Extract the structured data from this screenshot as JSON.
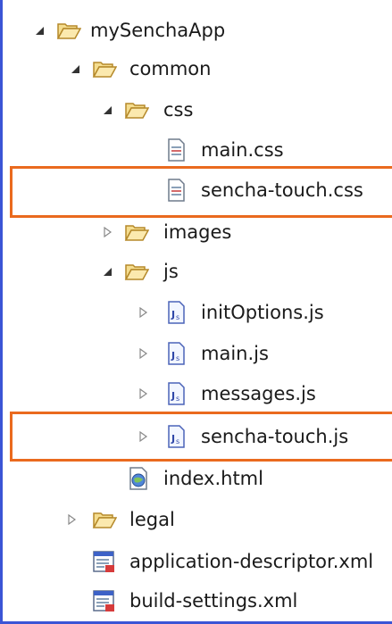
{
  "tree": {
    "root": {
      "label": "mySenchaApp",
      "expanded": true
    },
    "common": {
      "label": "common",
      "expanded": true
    },
    "css": {
      "label": "css",
      "expanded": true
    },
    "main_css": {
      "label": "main.css"
    },
    "sencha_css": {
      "label": "sencha-touch.css",
      "highlighted": true
    },
    "images": {
      "label": "images",
      "expanded": false
    },
    "js": {
      "label": "js",
      "expanded": true
    },
    "init_options": {
      "label": "initOptions.js",
      "expanded": false
    },
    "main_js": {
      "label": "main.js",
      "expanded": false
    },
    "messages_js": {
      "label": "messages.js",
      "expanded": false
    },
    "sencha_js": {
      "label": "sencha-touch.js",
      "expanded": false,
      "highlighted": true
    },
    "index_html": {
      "label": "index.html"
    },
    "legal": {
      "label": "legal",
      "expanded": false
    },
    "app_descriptor": {
      "label": "application-descriptor.xml"
    },
    "build_settings": {
      "label": "build-settings.xml"
    }
  },
  "colors": {
    "panel_border": "#3b55d6",
    "highlight": "#ea6a1e",
    "folder": "#e9c46a"
  }
}
